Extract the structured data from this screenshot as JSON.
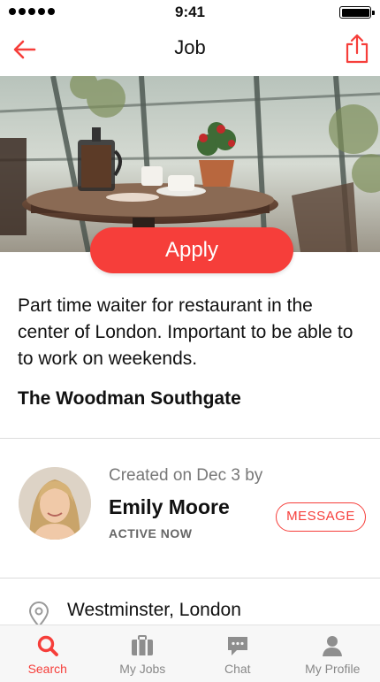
{
  "status_bar": {
    "time": "9:41"
  },
  "nav": {
    "title": "Job"
  },
  "job": {
    "apply_label": "Apply",
    "description": "Part time waiter for restaurant in the center of London. Important to be able to to work on weekends.",
    "business_name": "The Woodman Southgate",
    "location": "Westminster, London"
  },
  "poster": {
    "created_text": "Created on Dec 3 by",
    "name": "Emily Moore",
    "status": "ACTIVE NOW",
    "message_label": "MESSAGE"
  },
  "tabs": [
    {
      "label": "Search",
      "icon": "search-icon",
      "active": true
    },
    {
      "label": "My Jobs",
      "icon": "briefcase-icon",
      "active": false
    },
    {
      "label": "Chat",
      "icon": "chat-icon",
      "active": false
    },
    {
      "label": "My Profile",
      "icon": "profile-icon",
      "active": false
    }
  ],
  "colors": {
    "accent": "#f63e3a",
    "inactive": "#888888",
    "text": "#111111"
  }
}
